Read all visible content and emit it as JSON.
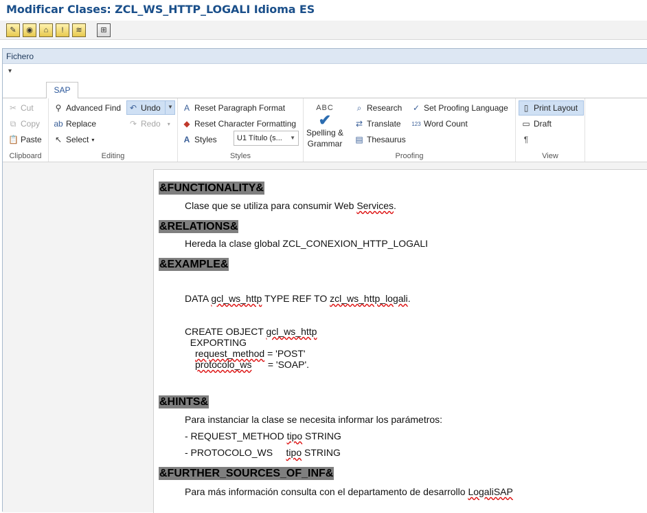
{
  "window": {
    "title": "Modificar Clases: ZCL_WS_HTTP_LOGALI Idioma ES"
  },
  "sap_toolbar": {
    "icons": [
      "edit-icon",
      "display-icon",
      "hierarchy-icon",
      "info-icon",
      "pattern-icon",
      "insert-icon"
    ]
  },
  "menu": {
    "fichero": "Fichero"
  },
  "qat": {
    "symbol": "▾"
  },
  "tabs": {
    "sap": "SAP"
  },
  "ribbon": {
    "clipboard": {
      "cut": "Cut",
      "copy": "Copy",
      "paste": "Paste",
      "label": "Clipboard"
    },
    "editing": {
      "advanced_find": "Advanced Find",
      "replace": "Replace",
      "select": "Select",
      "undo": "Undo",
      "redo": "Redo",
      "label": "Editing"
    },
    "styles": {
      "reset_paragraph": "Reset Paragraph Format",
      "reset_character": "Reset Character Formatting",
      "styles": "Styles",
      "style_value": "U1 Título (s...",
      "label": "Styles"
    },
    "proofing": {
      "spelling_line1": "Spelling &",
      "spelling_line2": "Grammar",
      "abc": "ABC",
      "research": "Research",
      "translate": "Translate",
      "thesaurus": "Thesaurus",
      "set_proofing": "Set Proofing Language",
      "word_count": "Word Count",
      "label": "Proofing"
    },
    "view": {
      "print_layout": "Print Layout",
      "draft": "Draft",
      "pilcrow": "¶",
      "label": "View"
    }
  },
  "document": {
    "h_functionality": "&FUNCTIONALITY&",
    "func_pre": "Clase que se utiliza para consumir Web ",
    "func_sq": "Services",
    "func_post": ".",
    "h_relations": "&RELATIONS&",
    "relations_text": "Hereda la clase global ZCL_CONEXION_HTTP_LOGALI",
    "h_example": "&EXAMPLE&",
    "data_pre": "DATA ",
    "data_sq1": "gcl_ws_http",
    "data_mid": " TYPE REF TO ",
    "data_sq2": "zcl_ws_http_logali",
    "data_post": ".",
    "create_pre": "CREATE OBJECT ",
    "create_sq": "gcl_ws_http",
    "exporting": "  EXPORTING",
    "req_sq": "request_method",
    "req_post": " = 'POST'",
    "proto_sq": "protocolo_ws",
    "proto_post": "      = 'SOAP'.",
    "h_hints": "&HINTS&",
    "hints_text": "Para instanciar la clase se necesita informar los parámetros:",
    "hint1_pre": "- REQUEST_METHOD ",
    "hint1_sq": "tipo",
    "hint1_post": " STRING",
    "hint2_pre": "- PROTOCOLO_WS     ",
    "hint2_sq": "tipo",
    "hint2_post": " STRING",
    "h_further": "&FURTHER_SOURCES_OF_INF&",
    "further_pre": "Para más información consulta con el departamento de desarrollo ",
    "further_sq": "LogaliSAP"
  }
}
